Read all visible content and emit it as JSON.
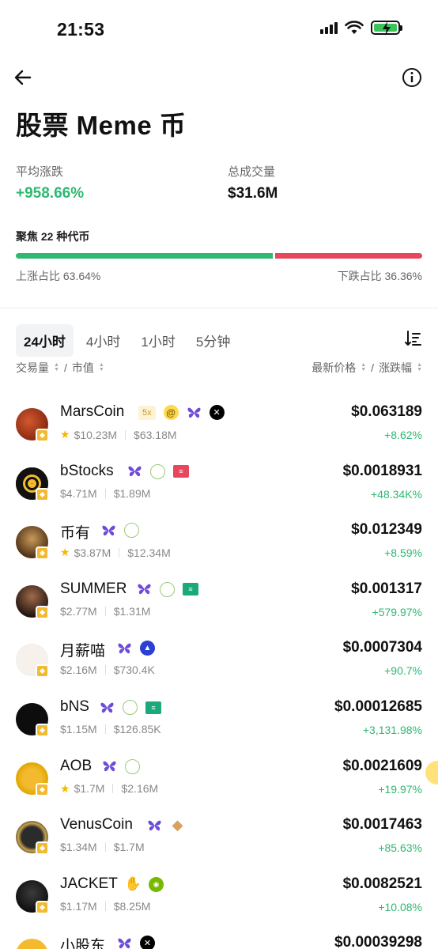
{
  "status": {
    "time": "21:53"
  },
  "header": {
    "title": "股票 Meme 币"
  },
  "stats": {
    "avg_change_label": "平均涨跌",
    "avg_change_value": "+958.66%",
    "total_volume_label": "总成交量",
    "total_volume_value": "$31.6M"
  },
  "focus": {
    "label": "聚焦 22 种代币",
    "up_ratio_pct": 63.64,
    "up_label": "上涨占比 63.64%",
    "down_label": "下跌占比 36.36%"
  },
  "tabs": [
    "24小时",
    "4小时",
    "1小时",
    "5分钟"
  ],
  "columns": {
    "left": "交易量",
    "left_sep": "/",
    "left2": "市值",
    "right": "最新价格",
    "right_sep": "/",
    "right2": "涨跌幅"
  },
  "coins": [
    {
      "name": "MarsCoin",
      "star": true,
      "volume": "$10.23M",
      "mcap": "$63.18M",
      "price": "$0.063189",
      "change": "+8.62%",
      "tags": [
        "5x",
        "at",
        "butterfly",
        "x"
      ]
    },
    {
      "name": "bStocks",
      "star": false,
      "volume": "$4.71M",
      "mcap": "$1.89M",
      "price": "$0.0018931",
      "change": "+48.34K%",
      "tags": [
        "butterfly",
        "spdr",
        "shop-red"
      ]
    },
    {
      "name": "币有",
      "star": true,
      "volume": "$3.87M",
      "mcap": "$12.34M",
      "price": "$0.012349",
      "change": "+8.59%",
      "tags": [
        "butterfly",
        "spdr"
      ]
    },
    {
      "name": "SUMMER",
      "star": false,
      "volume": "$2.77M",
      "mcap": "$1.31M",
      "price": "$0.001317",
      "change": "+579.97%",
      "tags": [
        "butterfly",
        "spdr",
        "shop-teal"
      ]
    },
    {
      "name": "月薪喵",
      "star": false,
      "volume": "$2.16M",
      "mcap": "$730.4K",
      "price": "$0.0007304",
      "change": "+90.7%",
      "tags": [
        "butterfly",
        "blue"
      ]
    },
    {
      "name": "bNS",
      "star": false,
      "volume": "$1.15M",
      "mcap": "$126.85K",
      "price": "$0.00012685",
      "change": "+3,131.98%",
      "tags": [
        "butterfly",
        "spdr",
        "shop-teal"
      ]
    },
    {
      "name": "AOB",
      "star": true,
      "volume": "$1.7M",
      "mcap": "$2.16M",
      "price": "$0.0021609",
      "change": "+19.97%",
      "tags": [
        "butterfly",
        "spdr"
      ]
    },
    {
      "name": "VenusCoin",
      "star": false,
      "volume": "$1.34M",
      "mcap": "$1.7M",
      "price": "$0.0017463",
      "change": "+85.63%",
      "tags": [
        "butterfly",
        "gem"
      ]
    },
    {
      "name": "JACKET",
      "star": false,
      "volume": "$1.17M",
      "mcap": "$8.25M",
      "price": "$0.0082521",
      "change": "+10.08%",
      "tags": [
        "hand",
        "nvidia"
      ]
    },
    {
      "name": "小股东",
      "star": false,
      "volume": "",
      "mcap": "",
      "price": "$0.00039298",
      "change": "",
      "tags": [
        "butterfly",
        "x"
      ]
    }
  ],
  "colors": {
    "up": "#2fb872",
    "down": "#e8465c",
    "accent_yellow": "#f3ba2f"
  }
}
